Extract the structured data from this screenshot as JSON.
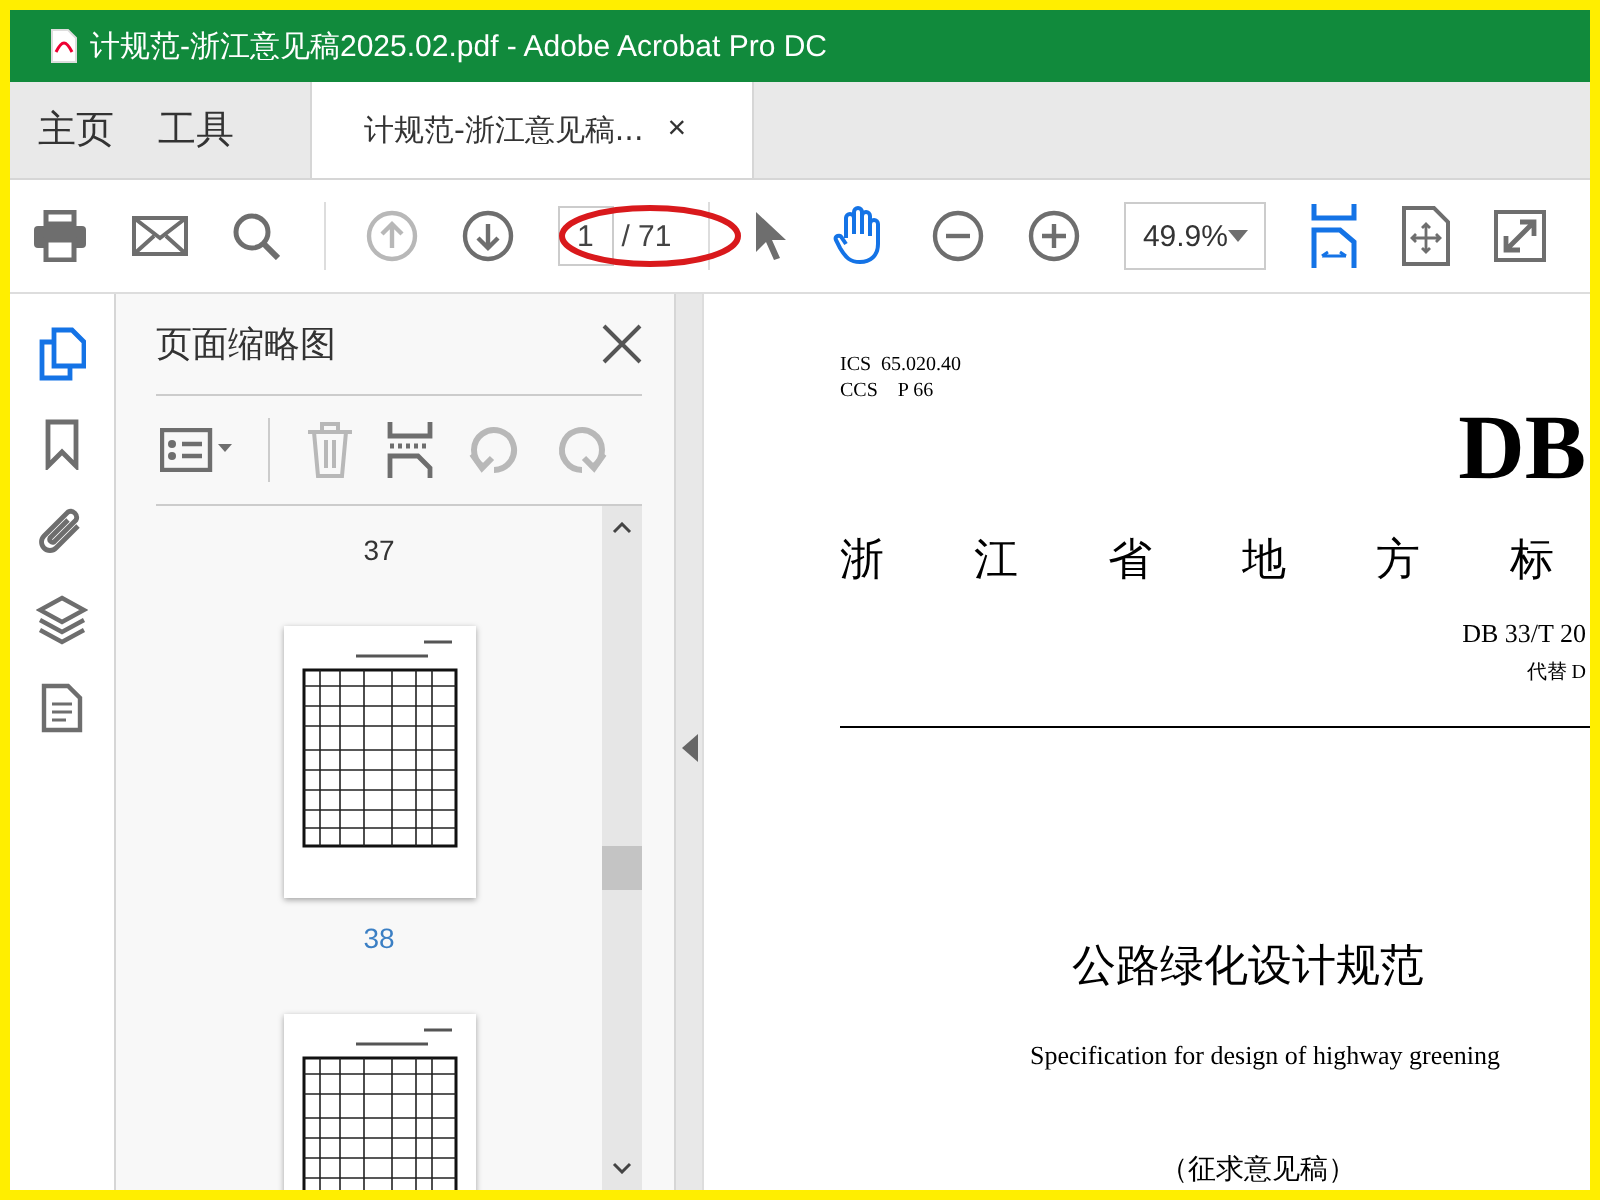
{
  "window": {
    "title": "计规范-浙江意见稿2025.02.pdf - Adobe Acrobat Pro DC"
  },
  "nav_tabs": [
    {
      "label": "主页"
    },
    {
      "label": "工具"
    }
  ],
  "document_tab": {
    "label": "计规范-浙江意见稿...",
    "close": "×"
  },
  "toolbar": {
    "prev_page_disabled": true,
    "page_input": "1",
    "page_total": "/ 71",
    "hand_tool_selected": true,
    "zoom": "49.9%"
  },
  "side_rail": [
    {
      "kind": "pages",
      "selected": true
    },
    {
      "kind": "bookmark",
      "selected": false
    },
    {
      "kind": "attachment",
      "selected": false
    },
    {
      "kind": "layers",
      "selected": false
    },
    {
      "kind": "document",
      "selected": false
    }
  ],
  "thumbnail_panel": {
    "title": "页面缩略图",
    "delete_disabled": true,
    "rotate_disabled": true,
    "thumbnails": [
      {
        "label": "37",
        "selected": false
      },
      {
        "label": "38",
        "selected": true
      }
    ]
  },
  "document": {
    "ics": "ICS  65.020.40",
    "ccs": "CCS    P 66",
    "code_mark": "DB",
    "province": "浙 江 省 地 方 标",
    "standard_number": "DB 33/T 20",
    "replaces": "代替 D",
    "title": "公路绿化设计规范",
    "subtitle": "Specification for design of highway greening",
    "status": "（征求意见稿）"
  }
}
